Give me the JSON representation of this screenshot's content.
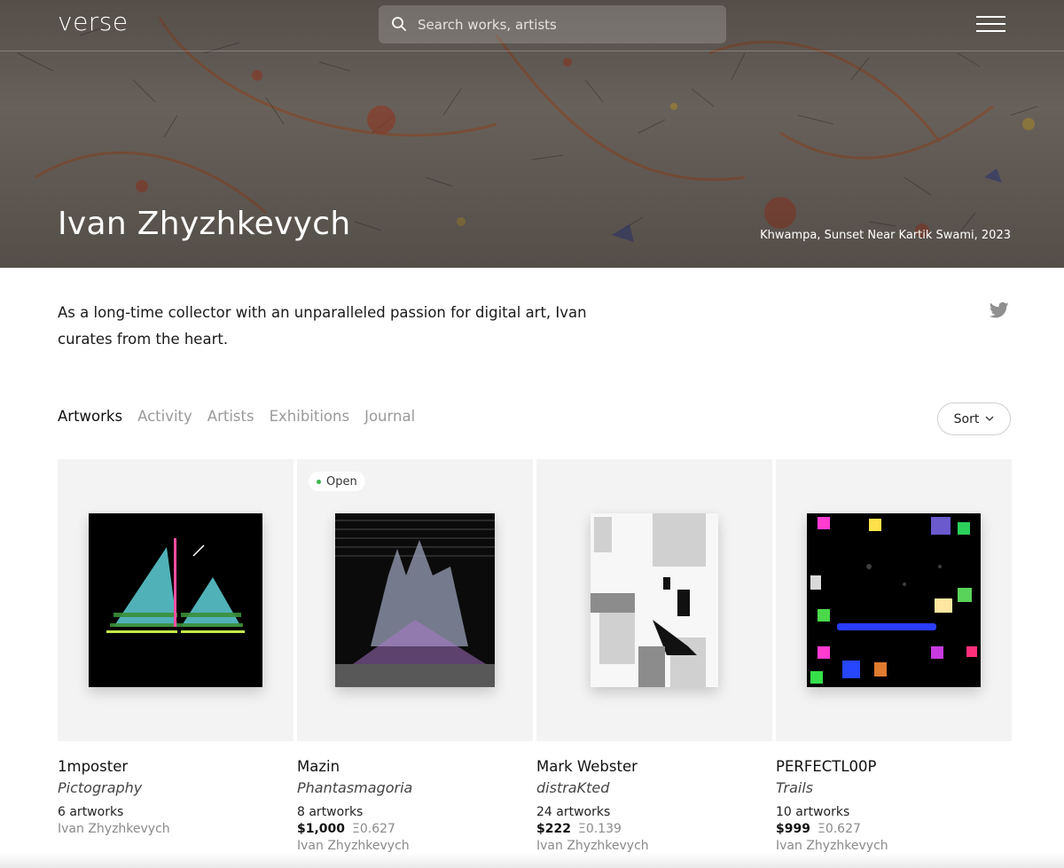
{
  "header": {
    "logo": "verse",
    "search_placeholder": "Search works, artists"
  },
  "hero": {
    "title": "Ivan Zhyzhkevych",
    "credit": "Khwampa, Sunset Near Kartik Swami, 2023"
  },
  "bio": "As a long-time collector with an unparalleled passion for digital art, Ivan curates from the heart.",
  "tabs": [
    {
      "label": "Artworks",
      "active": true
    },
    {
      "label": "Activity",
      "active": false
    },
    {
      "label": "Artists",
      "active": false
    },
    {
      "label": "Exhibitions",
      "active": false
    },
    {
      "label": "Journal",
      "active": false
    }
  ],
  "sort_label": "Sort",
  "cards": [
    {
      "artist": "1mposter",
      "series": "Pictography",
      "count": "6 artworks",
      "price_usd": "",
      "price_eth": "",
      "curator": "Ivan Zhyzhkevych",
      "badge": ""
    },
    {
      "artist": "Mazin",
      "series": "Phantasmagoria",
      "count": "8 artworks",
      "price_usd": "$1,000",
      "price_eth": "Ξ0.627",
      "curator": "Ivan Zhyzhkevych",
      "badge": "Open"
    },
    {
      "artist": "Mark Webster",
      "series": "distraKted",
      "count": "24 artworks",
      "price_usd": "$222",
      "price_eth": "Ξ0.139",
      "curator": "Ivan Zhyzhkevych",
      "badge": ""
    },
    {
      "artist": "PERFECTL00P",
      "series": "Trails",
      "count": "10 artworks",
      "price_usd": "$999",
      "price_eth": "Ξ0.627",
      "curator": "Ivan Zhyzhkevych",
      "badge": ""
    }
  ],
  "colors": {
    "badge_dot": "#3bb54a",
    "card_bg": "#f3f3f3"
  },
  "icons": {
    "search": "search-icon",
    "menu": "hamburger-menu-icon",
    "twitter": "twitter-icon",
    "sort": "chevron-down-icon"
  }
}
